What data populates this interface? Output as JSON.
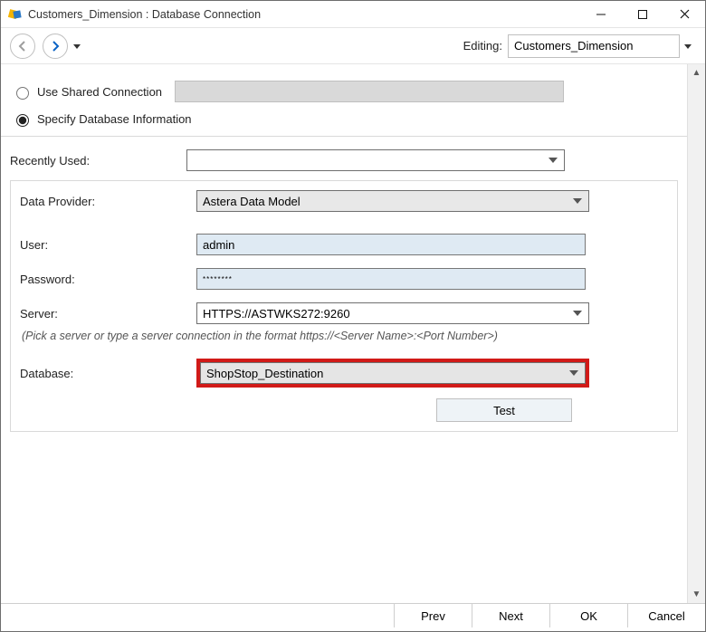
{
  "window": {
    "title": "Customers_Dimension : Database Connection"
  },
  "toolbar": {
    "editing_label": "Editing:",
    "editing_value": "Customers_Dimension"
  },
  "connection_type": {
    "use_shared_label": "Use Shared Connection",
    "specify_label": "Specify Database Information",
    "selected": "specify"
  },
  "recently_used": {
    "label": "Recently Used:",
    "value": ""
  },
  "form": {
    "data_provider": {
      "label": "Data Provider:",
      "value": "Astera Data Model"
    },
    "user": {
      "label": "User:",
      "value": "admin"
    },
    "password": {
      "label": "Password:",
      "value": "********"
    },
    "server": {
      "label": "Server:",
      "value": "HTTPS://ASTWKS272:9260"
    },
    "server_hint": "(Pick a server or type a server connection in the format  https://<Server Name>:<Port Number>)",
    "database": {
      "label": "Database:",
      "value": "ShopStop_Destination"
    },
    "test_label": "Test"
  },
  "footer": {
    "prev": "Prev",
    "next": "Next",
    "ok": "OK",
    "cancel": "Cancel"
  }
}
